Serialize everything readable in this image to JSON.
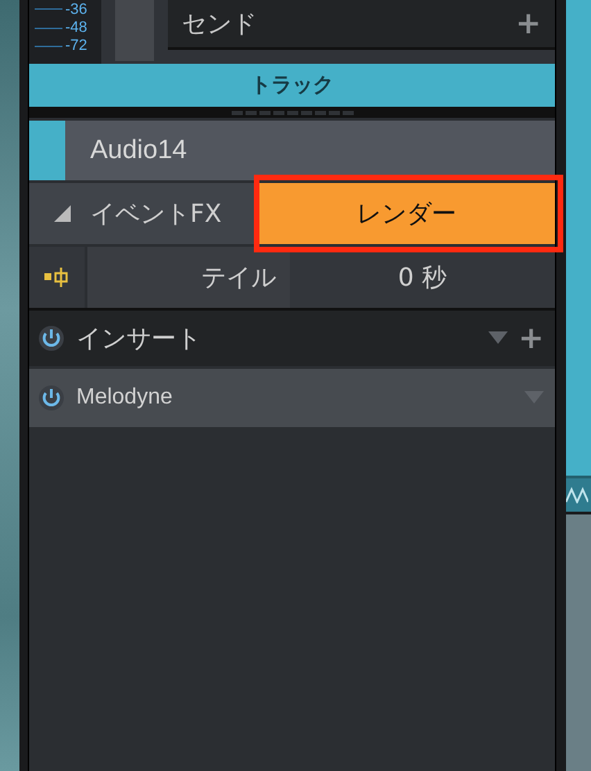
{
  "meter": {
    "labels": [
      "-36",
      "-48",
      "-72"
    ]
  },
  "sends": {
    "title": "センド",
    "add": "+"
  },
  "track_tab": {
    "label": "トラック"
  },
  "track": {
    "name": "Audio14",
    "color": "#45b0c8"
  },
  "event_fx": {
    "label": "イベントFX",
    "expanded": true,
    "render_button": "レンダー",
    "highlighted": true
  },
  "tail": {
    "label": "テイル",
    "value": "0 秒"
  },
  "inserts": {
    "title": "インサート",
    "enabled": true,
    "add": "+",
    "items": [
      {
        "name": "Melodyne",
        "enabled": true
      }
    ]
  }
}
